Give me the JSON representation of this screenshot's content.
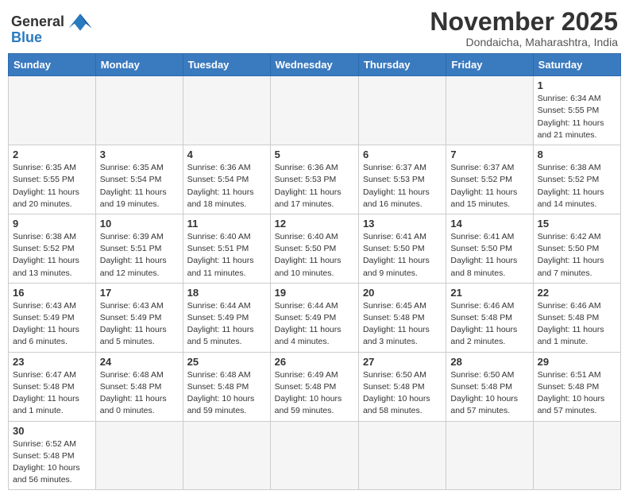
{
  "logo": {
    "text_general": "General",
    "text_blue": "Blue"
  },
  "title": "November 2025",
  "location": "Dondaicha, Maharashtra, India",
  "weekdays": [
    "Sunday",
    "Monday",
    "Tuesday",
    "Wednesday",
    "Thursday",
    "Friday",
    "Saturday"
  ],
  "weeks": [
    [
      {
        "day": "",
        "info": ""
      },
      {
        "day": "",
        "info": ""
      },
      {
        "day": "",
        "info": ""
      },
      {
        "day": "",
        "info": ""
      },
      {
        "day": "",
        "info": ""
      },
      {
        "day": "",
        "info": ""
      },
      {
        "day": "1",
        "info": "Sunrise: 6:34 AM\nSunset: 5:55 PM\nDaylight: 11 hours and 21 minutes."
      }
    ],
    [
      {
        "day": "2",
        "info": "Sunrise: 6:35 AM\nSunset: 5:55 PM\nDaylight: 11 hours and 20 minutes."
      },
      {
        "day": "3",
        "info": "Sunrise: 6:35 AM\nSunset: 5:54 PM\nDaylight: 11 hours and 19 minutes."
      },
      {
        "day": "4",
        "info": "Sunrise: 6:36 AM\nSunset: 5:54 PM\nDaylight: 11 hours and 18 minutes."
      },
      {
        "day": "5",
        "info": "Sunrise: 6:36 AM\nSunset: 5:53 PM\nDaylight: 11 hours and 17 minutes."
      },
      {
        "day": "6",
        "info": "Sunrise: 6:37 AM\nSunset: 5:53 PM\nDaylight: 11 hours and 16 minutes."
      },
      {
        "day": "7",
        "info": "Sunrise: 6:37 AM\nSunset: 5:52 PM\nDaylight: 11 hours and 15 minutes."
      },
      {
        "day": "8",
        "info": "Sunrise: 6:38 AM\nSunset: 5:52 PM\nDaylight: 11 hours and 14 minutes."
      }
    ],
    [
      {
        "day": "9",
        "info": "Sunrise: 6:38 AM\nSunset: 5:52 PM\nDaylight: 11 hours and 13 minutes."
      },
      {
        "day": "10",
        "info": "Sunrise: 6:39 AM\nSunset: 5:51 PM\nDaylight: 11 hours and 12 minutes."
      },
      {
        "day": "11",
        "info": "Sunrise: 6:40 AM\nSunset: 5:51 PM\nDaylight: 11 hours and 11 minutes."
      },
      {
        "day": "12",
        "info": "Sunrise: 6:40 AM\nSunset: 5:50 PM\nDaylight: 11 hours and 10 minutes."
      },
      {
        "day": "13",
        "info": "Sunrise: 6:41 AM\nSunset: 5:50 PM\nDaylight: 11 hours and 9 minutes."
      },
      {
        "day": "14",
        "info": "Sunrise: 6:41 AM\nSunset: 5:50 PM\nDaylight: 11 hours and 8 minutes."
      },
      {
        "day": "15",
        "info": "Sunrise: 6:42 AM\nSunset: 5:50 PM\nDaylight: 11 hours and 7 minutes."
      }
    ],
    [
      {
        "day": "16",
        "info": "Sunrise: 6:43 AM\nSunset: 5:49 PM\nDaylight: 11 hours and 6 minutes."
      },
      {
        "day": "17",
        "info": "Sunrise: 6:43 AM\nSunset: 5:49 PM\nDaylight: 11 hours and 5 minutes."
      },
      {
        "day": "18",
        "info": "Sunrise: 6:44 AM\nSunset: 5:49 PM\nDaylight: 11 hours and 5 minutes."
      },
      {
        "day": "19",
        "info": "Sunrise: 6:44 AM\nSunset: 5:49 PM\nDaylight: 11 hours and 4 minutes."
      },
      {
        "day": "20",
        "info": "Sunrise: 6:45 AM\nSunset: 5:48 PM\nDaylight: 11 hours and 3 minutes."
      },
      {
        "day": "21",
        "info": "Sunrise: 6:46 AM\nSunset: 5:48 PM\nDaylight: 11 hours and 2 minutes."
      },
      {
        "day": "22",
        "info": "Sunrise: 6:46 AM\nSunset: 5:48 PM\nDaylight: 11 hours and 1 minute."
      }
    ],
    [
      {
        "day": "23",
        "info": "Sunrise: 6:47 AM\nSunset: 5:48 PM\nDaylight: 11 hours and 1 minute."
      },
      {
        "day": "24",
        "info": "Sunrise: 6:48 AM\nSunset: 5:48 PM\nDaylight: 11 hours and 0 minutes."
      },
      {
        "day": "25",
        "info": "Sunrise: 6:48 AM\nSunset: 5:48 PM\nDaylight: 10 hours and 59 minutes."
      },
      {
        "day": "26",
        "info": "Sunrise: 6:49 AM\nSunset: 5:48 PM\nDaylight: 10 hours and 59 minutes."
      },
      {
        "day": "27",
        "info": "Sunrise: 6:50 AM\nSunset: 5:48 PM\nDaylight: 10 hours and 58 minutes."
      },
      {
        "day": "28",
        "info": "Sunrise: 6:50 AM\nSunset: 5:48 PM\nDaylight: 10 hours and 57 minutes."
      },
      {
        "day": "29",
        "info": "Sunrise: 6:51 AM\nSunset: 5:48 PM\nDaylight: 10 hours and 57 minutes."
      }
    ],
    [
      {
        "day": "30",
        "info": "Sunrise: 6:52 AM\nSunset: 5:48 PM\nDaylight: 10 hours and 56 minutes."
      },
      {
        "day": "",
        "info": ""
      },
      {
        "day": "",
        "info": ""
      },
      {
        "day": "",
        "info": ""
      },
      {
        "day": "",
        "info": ""
      },
      {
        "day": "",
        "info": ""
      },
      {
        "day": "",
        "info": ""
      }
    ]
  ]
}
